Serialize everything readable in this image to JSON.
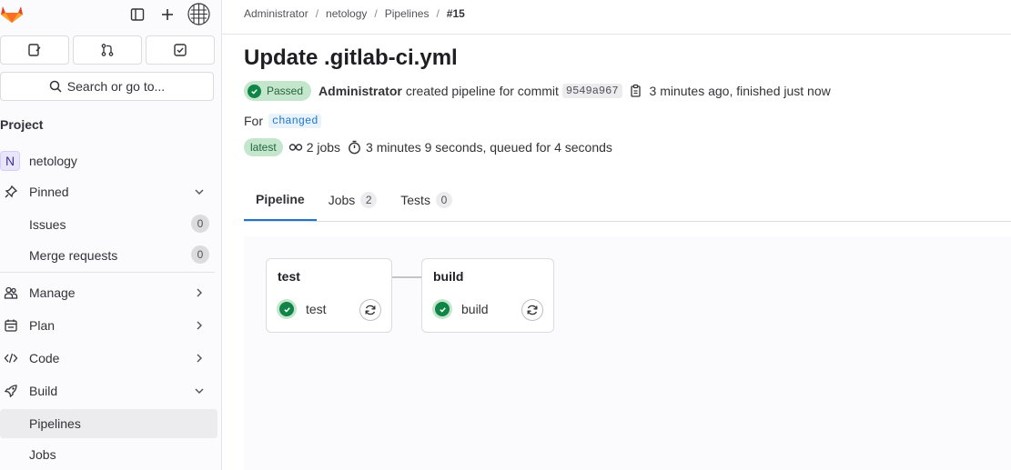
{
  "sidebar": {
    "search_label": "Search or go to...",
    "section_title": "Project",
    "project": {
      "initial": "N",
      "name": "netology"
    },
    "pinned": {
      "label": "Pinned",
      "items": [
        {
          "label": "Issues",
          "count": "0"
        },
        {
          "label": "Merge requests",
          "count": "0"
        }
      ]
    },
    "nav": [
      {
        "label": "Manage"
      },
      {
        "label": "Plan"
      },
      {
        "label": "Code"
      },
      {
        "label": "Build"
      }
    ],
    "build_items": [
      {
        "label": "Pipelines",
        "active": true
      },
      {
        "label": "Jobs"
      }
    ]
  },
  "breadcrumb": [
    "Administrator",
    "netology",
    "Pipelines",
    "#15"
  ],
  "pipeline": {
    "title": "Update .gitlab-ci.yml",
    "status": "Passed",
    "author": "Administrator",
    "action_text": "created pipeline for commit",
    "sha": "9549a967",
    "time_text": "3 minutes ago, finished just now",
    "for_label": "For",
    "ref": "changed",
    "latest_badge": "latest",
    "jobs_text": "2 jobs",
    "duration_text": "3 minutes 9 seconds, queued for 4 seconds"
  },
  "tabs": [
    {
      "label": "Pipeline",
      "active": true
    },
    {
      "label": "Jobs",
      "count": "2"
    },
    {
      "label": "Tests",
      "count": "0"
    }
  ],
  "stages": [
    {
      "name": "test",
      "job": "test",
      "status": "success"
    },
    {
      "name": "build",
      "job": "build",
      "status": "success"
    }
  ],
  "colors": {
    "success": "#108548",
    "success_bg": "#c3e6cd",
    "active_tab": "#1f75cb"
  }
}
